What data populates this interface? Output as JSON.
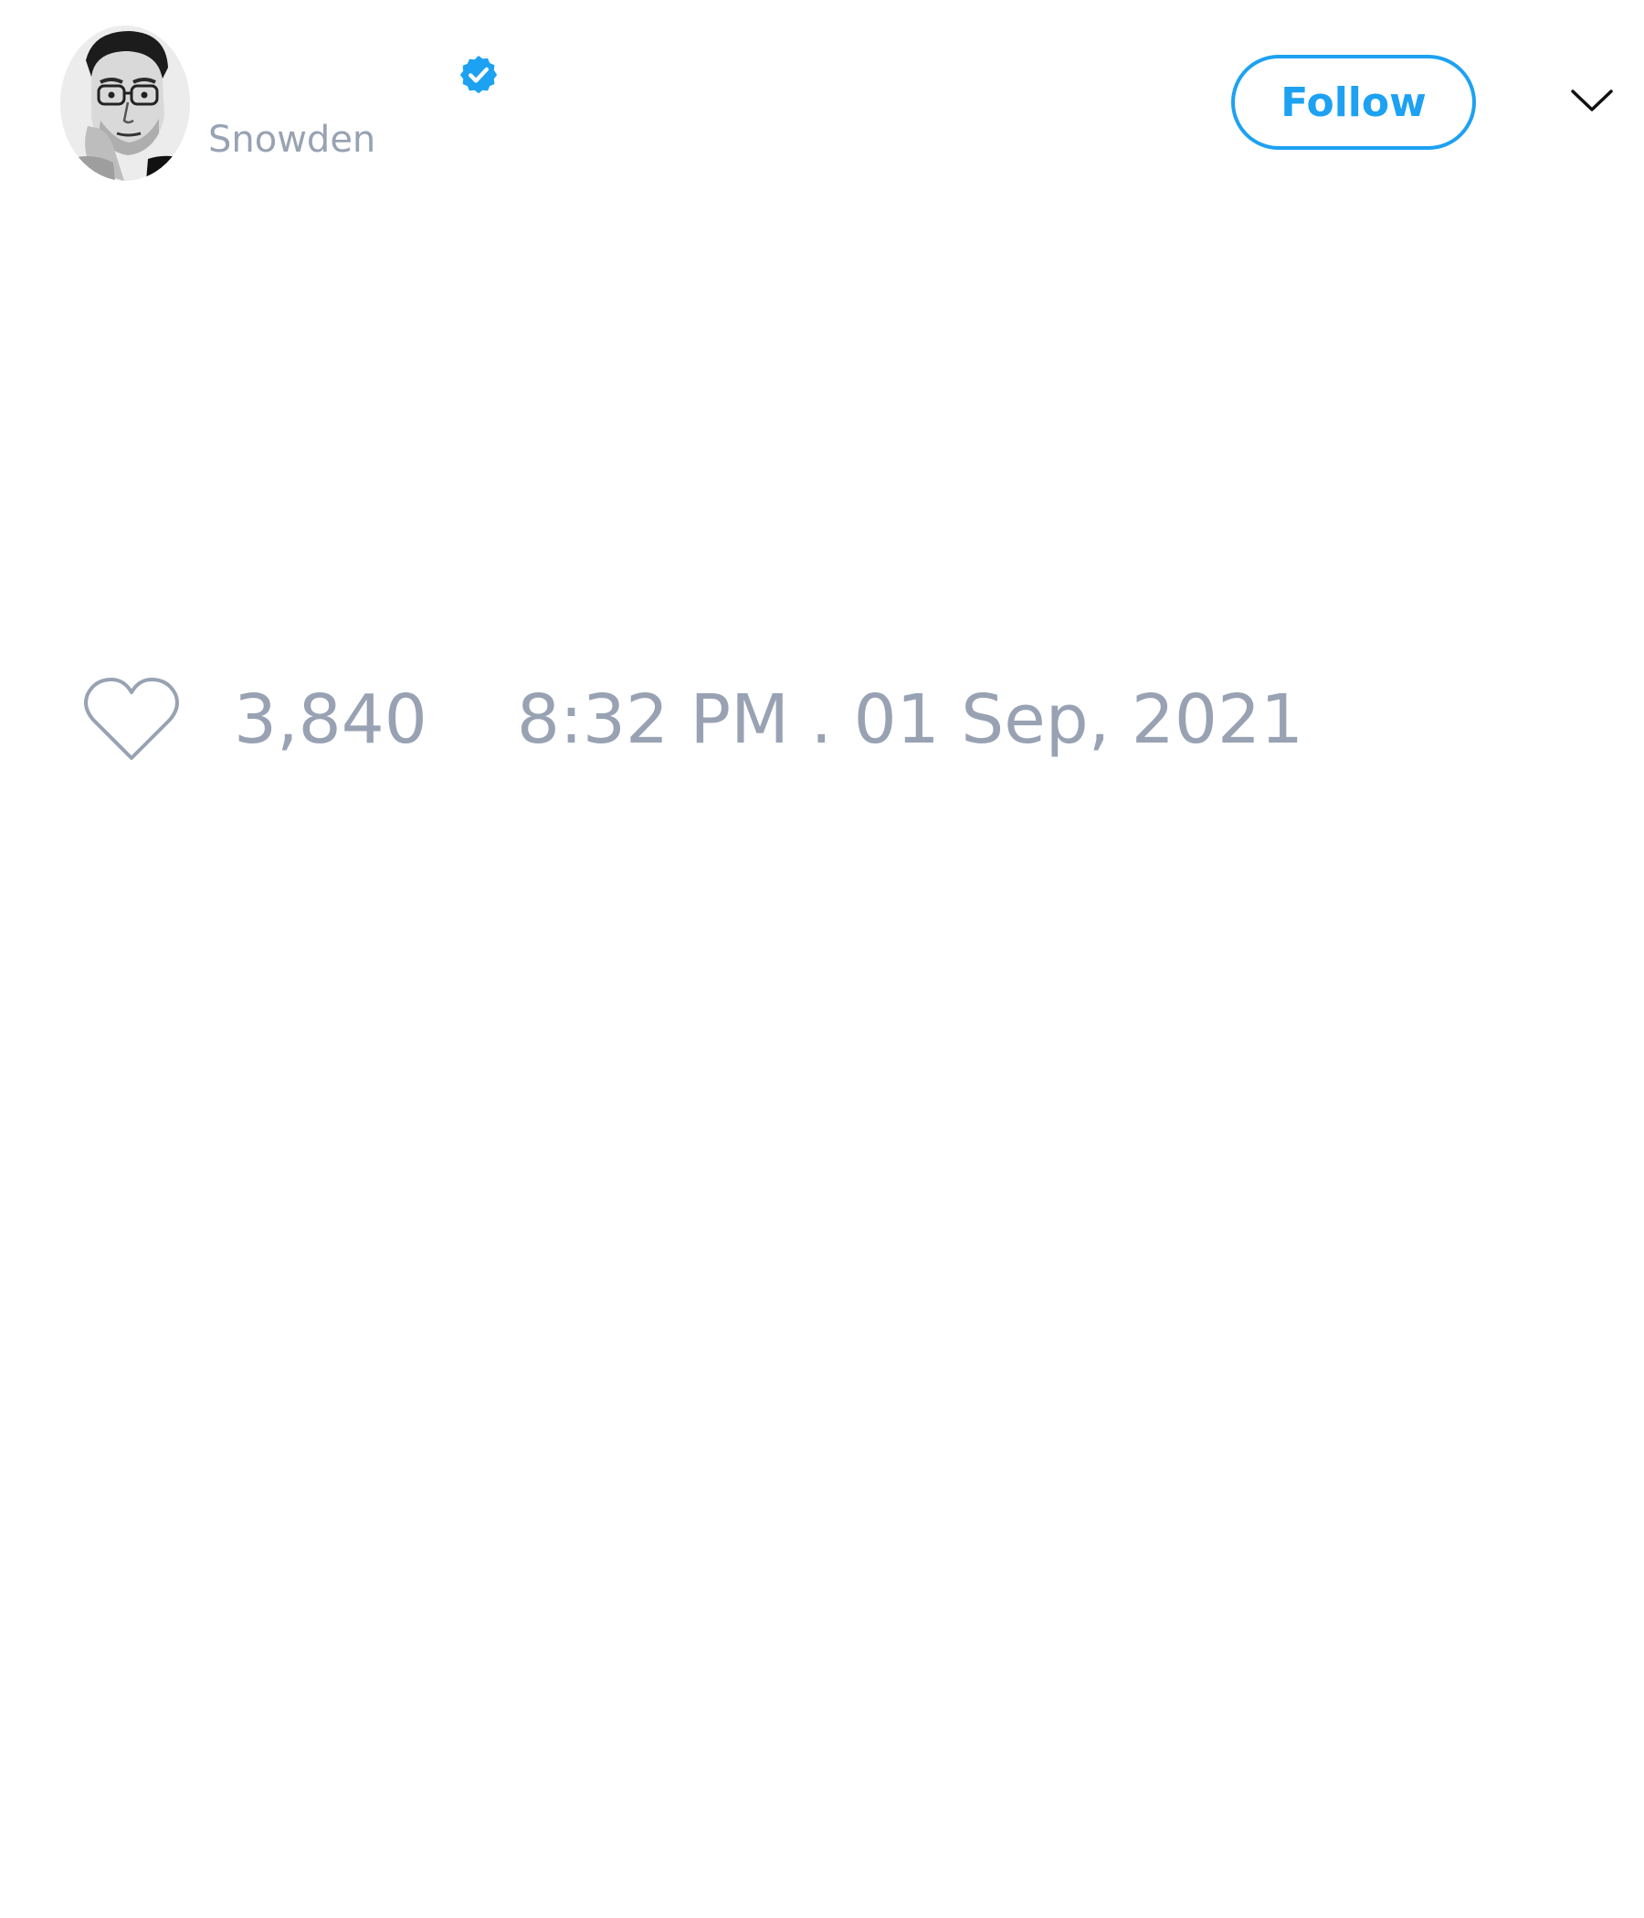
{
  "author": {
    "display_name": "",
    "username": "Snowden",
    "verified": true,
    "avatar_icon": "profile-photo"
  },
  "actions": {
    "follow_label": "Follow",
    "menu_icon": "chevron-down-icon"
  },
  "tweet": {
    "text": ""
  },
  "stats": {
    "like_icon": "heart-outline-icon",
    "like_count": "3,840",
    "timestamp": "8:32 PM . 01 Sep, 2021"
  },
  "colors": {
    "accent": "#1da1f2",
    "muted_text": "#98a2b3",
    "background": "#ffffff"
  }
}
